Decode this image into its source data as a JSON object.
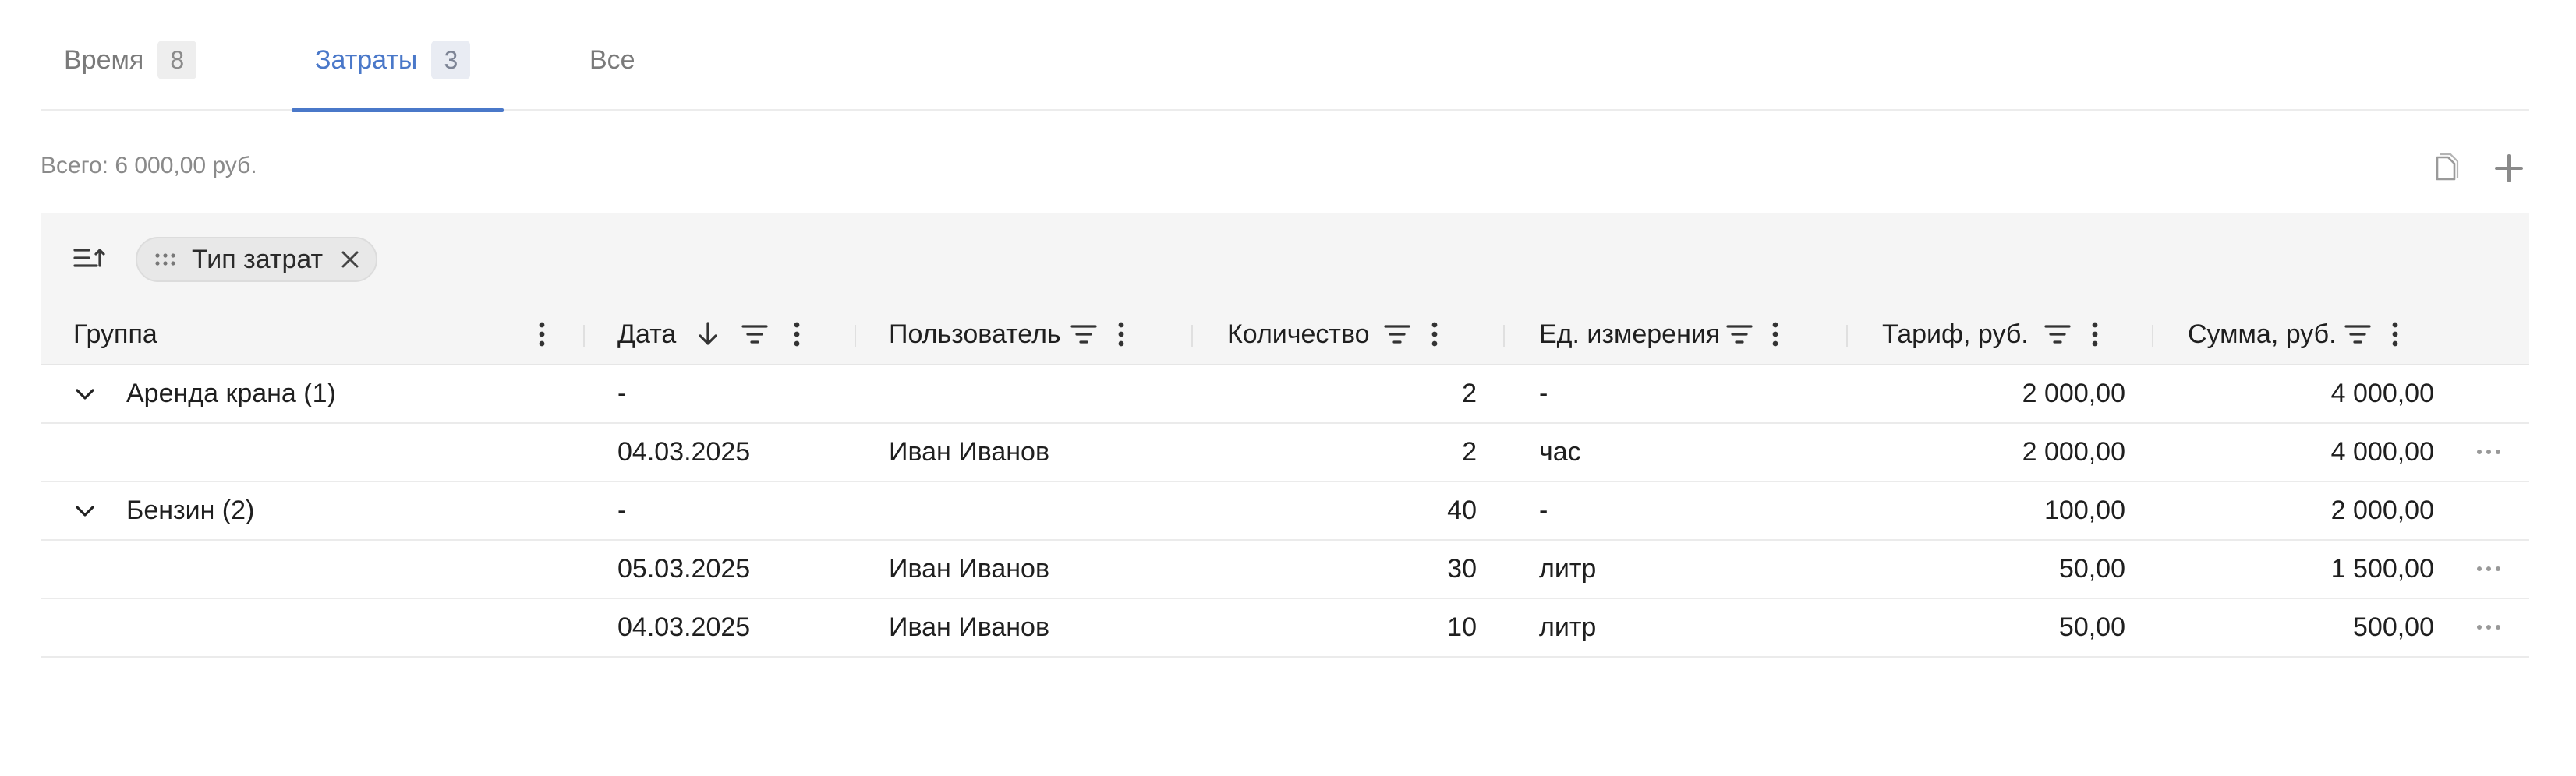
{
  "tabs": [
    {
      "label": "Время",
      "count": "8",
      "active": false
    },
    {
      "label": "Затраты",
      "count": "3",
      "active": true
    },
    {
      "label": "Все",
      "count": null,
      "active": false
    }
  ],
  "summary": {
    "total": "Всего: 6 000,00 руб."
  },
  "toolbar": {
    "copy_icon": "document-icon",
    "add_icon": "plus-icon"
  },
  "grouping": {
    "chip_label": "Тип затрат"
  },
  "columns": {
    "group": "Группа",
    "date": "Дата",
    "user": "Пользователь",
    "qty": "Количество",
    "unit": "Ед. измерения",
    "rate": "Тариф, руб.",
    "sum": "Сумма, руб."
  },
  "rows": [
    {
      "type": "group",
      "label": "Аренда крана (1)",
      "date": "-",
      "user": "",
      "qty": "2",
      "unit": "-",
      "rate": "2 000,00",
      "sum": "4 000,00"
    },
    {
      "type": "item",
      "label": "",
      "date": "04.03.2025",
      "user": "Иван Иванов",
      "qty": "2",
      "unit": "час",
      "rate": "2 000,00",
      "sum": "4 000,00"
    },
    {
      "type": "group",
      "label": "Бензин (2)",
      "date": "-",
      "user": "",
      "qty": "40",
      "unit": "-",
      "rate": "100,00",
      "sum": "2 000,00"
    },
    {
      "type": "item",
      "label": "",
      "date": "05.03.2025",
      "user": "Иван Иванов",
      "qty": "30",
      "unit": "литр",
      "rate": "50,00",
      "sum": "1 500,00"
    },
    {
      "type": "item",
      "label": "",
      "date": "04.03.2025",
      "user": "Иван Иванов",
      "qty": "10",
      "unit": "литр",
      "rate": "50,00",
      "sum": "500,00"
    }
  ],
  "colors": {
    "accent": "#4a78c9",
    "panel_bg": "#f5f5f5",
    "muted_text": "#8a8a8a"
  }
}
